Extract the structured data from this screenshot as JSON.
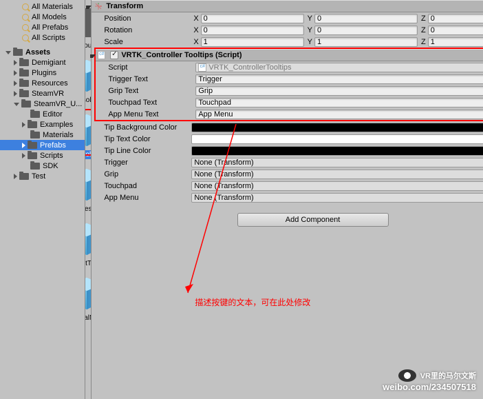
{
  "hierarchy": {
    "searches": [
      "All Materials",
      "All Models",
      "All Prefabs",
      "All Scripts"
    ],
    "assets_label": "Assets",
    "folders_l1": [
      "Demigiant",
      "Plugins",
      "Resources",
      "SteamVR"
    ],
    "steamvr_u": "SteamVR_U...",
    "folders_l3": [
      "Editor",
      "Examples",
      "Materials",
      "Prefabs",
      "Scripts",
      "SDK"
    ],
    "test": "Test"
  },
  "assets_grid": [
    {
      "label": "Resources",
      "type": "folder"
    },
    {
      "label": "ConsoleVi...",
      "type": "cube"
    },
    {
      "label": "ControllerT...",
      "type": "cube",
      "selected": true,
      "circled": true
    },
    {
      "label": "FramesPer...",
      "type": "cube"
    },
    {
      "label": "ObjectToolti...",
      "type": "cube"
    },
    {
      "label": "RadialMenu",
      "type": "cube"
    }
  ],
  "inspector": {
    "transform": {
      "title": "Transform",
      "rows": [
        {
          "label": "Position",
          "x": "0",
          "y": "0",
          "z": "0"
        },
        {
          "label": "Rotation",
          "x": "0",
          "y": "0",
          "z": "0"
        },
        {
          "label": "Scale",
          "x": "1",
          "y": "1",
          "z": "1"
        }
      ]
    },
    "tooltips": {
      "title": "VRTK_Controller Tooltips (Script)",
      "script_label": "Script",
      "script_value": "VRTK_ControllerTooltips",
      "text_rows": [
        {
          "label": "Trigger Text",
          "value": "Trigger"
        },
        {
          "label": "Grip Text",
          "value": "Grip"
        },
        {
          "label": "Touchpad Text",
          "value": "Touchpad"
        },
        {
          "label": "App Menu Text",
          "value": "App Menu"
        }
      ],
      "color_rows": [
        {
          "label": "Tip Background Color",
          "color": "#000000"
        },
        {
          "label": "Tip Text Color",
          "color": "#ffffff"
        },
        {
          "label": "Tip Line Color",
          "color": "#000000"
        }
      ],
      "obj_rows": [
        {
          "label": "Trigger",
          "value": "None (Transform)"
        },
        {
          "label": "Grip",
          "value": "None (Transform)"
        },
        {
          "label": "Touchpad",
          "value": "None (Transform)"
        },
        {
          "label": "App Menu",
          "value": "None (Transform)"
        }
      ]
    },
    "add_component": "Add Component"
  },
  "annotation": "描述按键的文本，可在此处修改",
  "watermark": {
    "name": "VR里的马尔文斯",
    "url": "weibo.com/234507518"
  }
}
